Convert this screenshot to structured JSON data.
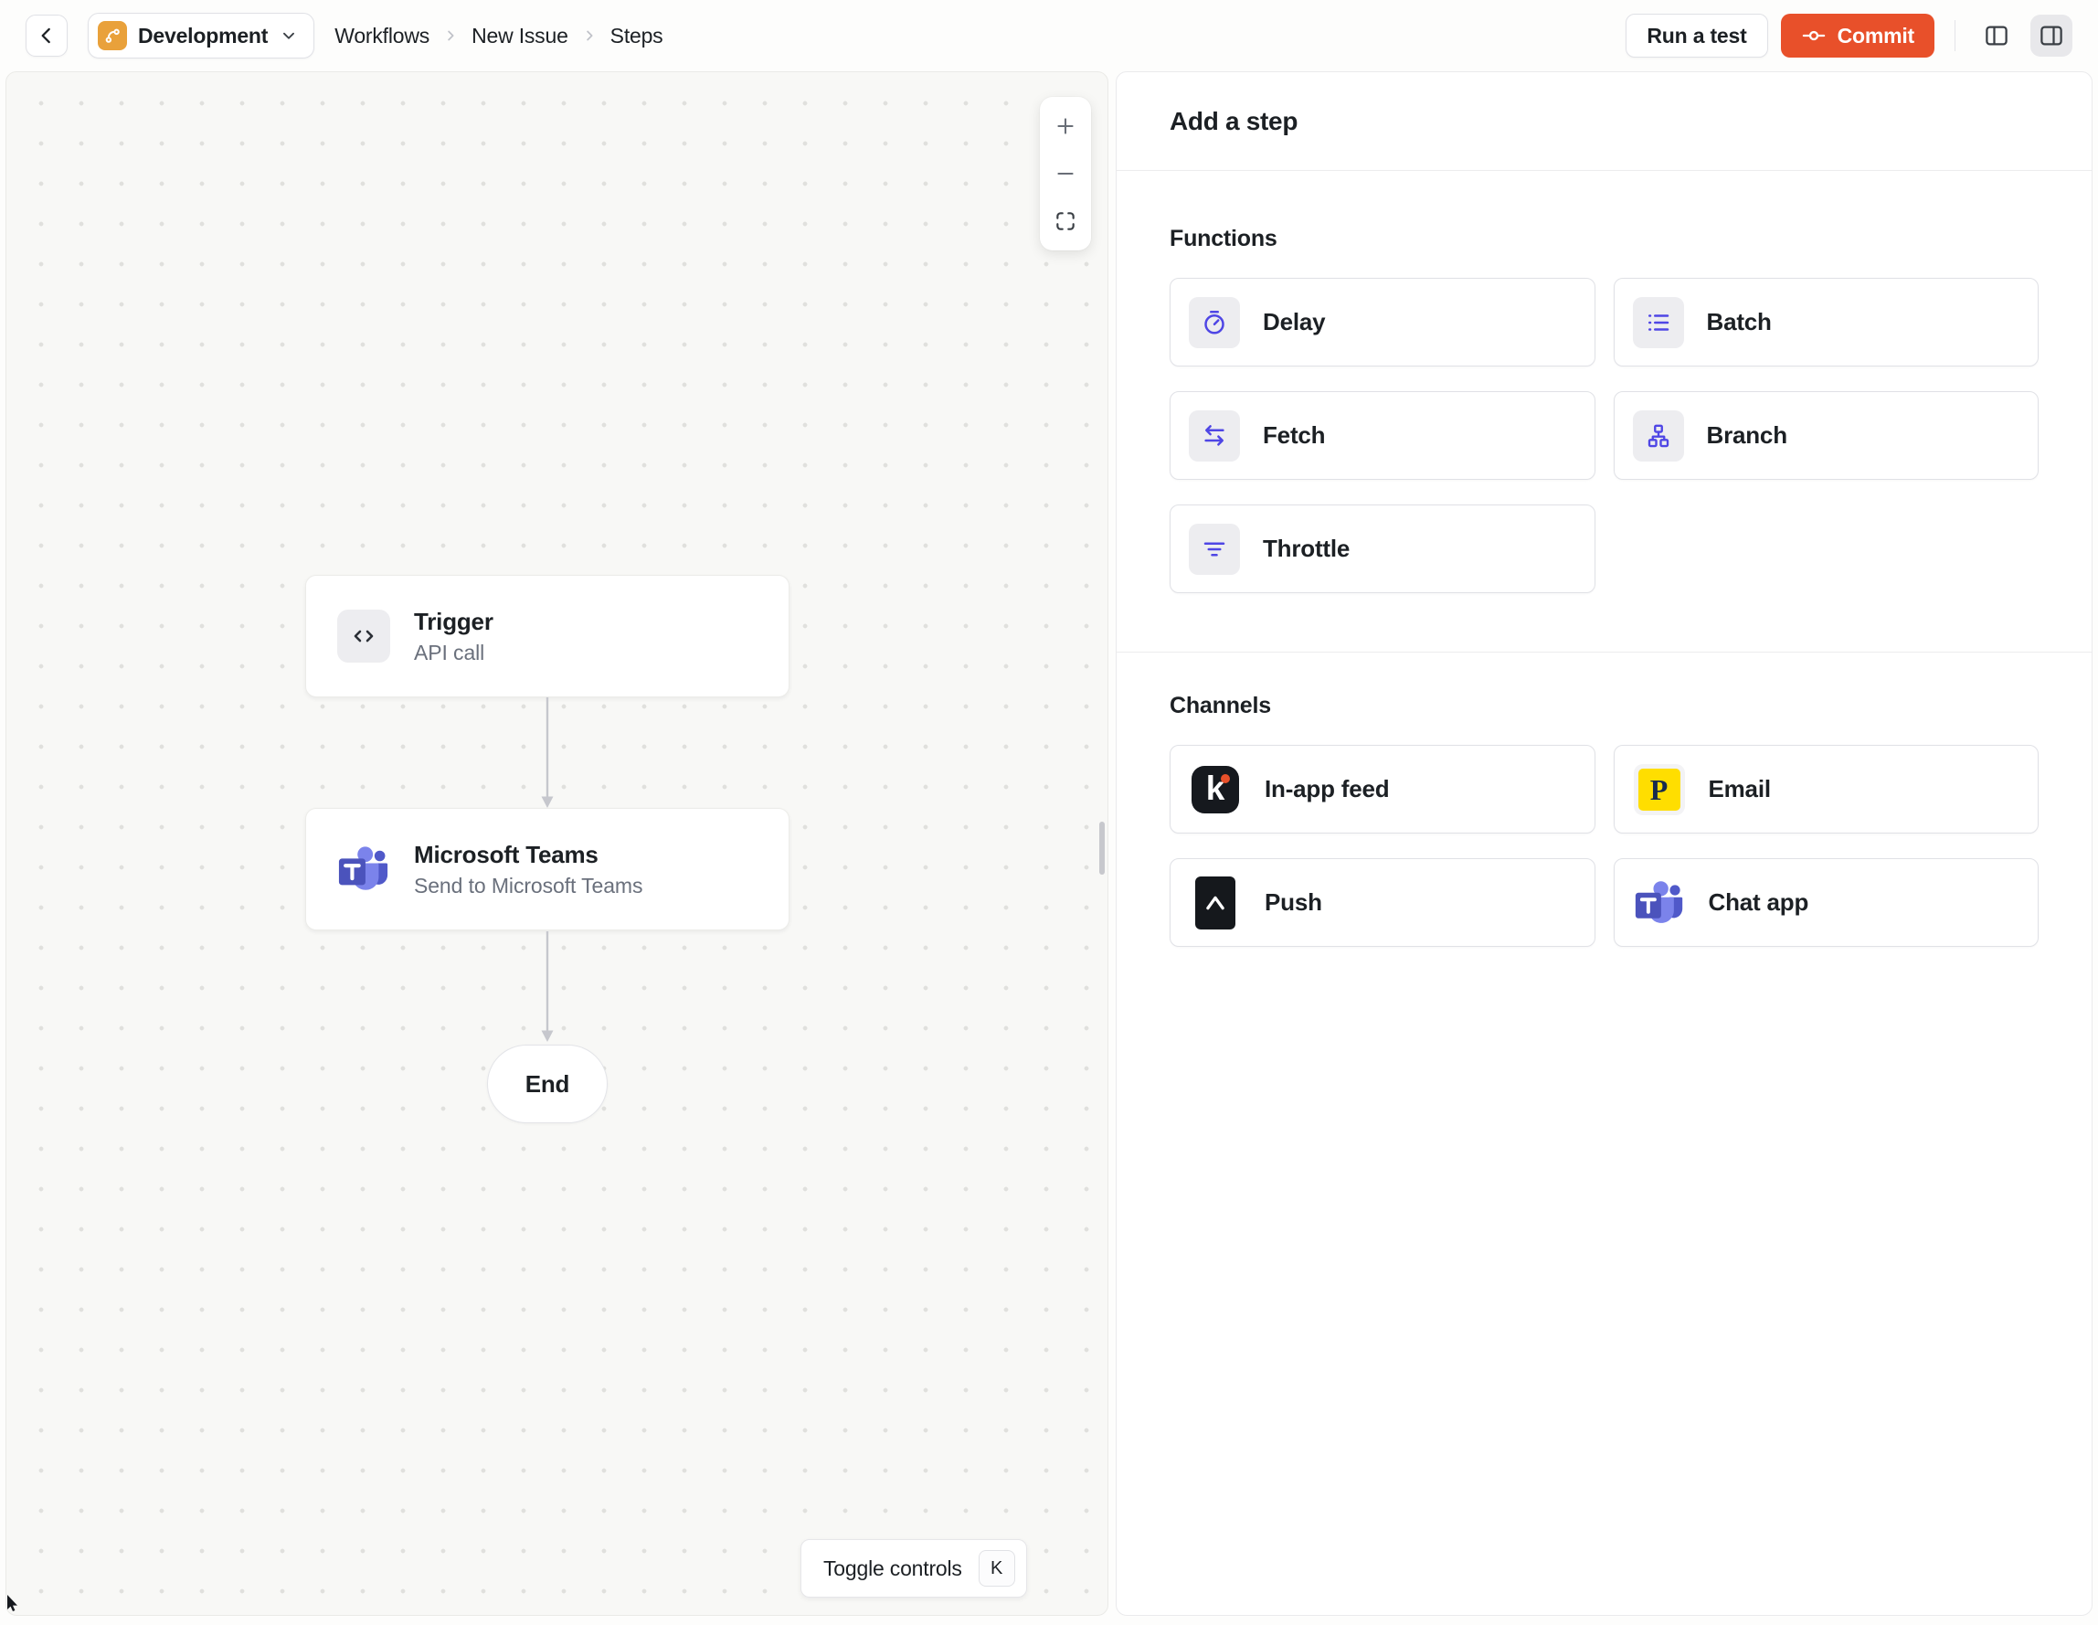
{
  "topbar": {
    "environment": "Development",
    "breadcrumb": [
      "Workflows",
      "New Issue",
      "Steps"
    ],
    "run_test_label": "Run a test",
    "commit_label": "Commit"
  },
  "canvas": {
    "trigger_node": {
      "title": "Trigger",
      "subtitle": "API call",
      "icon": "code-icon"
    },
    "teams_node": {
      "title": "Microsoft Teams",
      "subtitle": "Send to Microsoft Teams",
      "icon": "ms-teams-icon"
    },
    "end_label": "End",
    "zoom_controls": [
      "zoom-in",
      "zoom-out",
      "fit-view"
    ],
    "toggle_controls": {
      "label": "Toggle controls",
      "shortcut": "K"
    }
  },
  "panel": {
    "title": "Add a step",
    "sections": [
      {
        "label": "Functions",
        "items": [
          {
            "label": "Delay",
            "icon": "stopwatch-icon"
          },
          {
            "label": "Batch",
            "icon": "list-icon"
          },
          {
            "label": "Fetch",
            "icon": "transfer-arrows-icon"
          },
          {
            "label": "Branch",
            "icon": "org-chart-icon"
          },
          {
            "label": "Throttle",
            "icon": "funnel-lines-icon"
          }
        ]
      },
      {
        "label": "Channels",
        "items": [
          {
            "label": "In-app feed",
            "icon": "knock-logo"
          },
          {
            "label": "Email",
            "icon": "postmark-logo"
          },
          {
            "label": "Push",
            "icon": "expo-logo"
          },
          {
            "label": "Chat app",
            "icon": "ms-teams-icon"
          }
        ]
      }
    ]
  },
  "colors": {
    "commit_accent": "#E8502A",
    "function_icon": "#4F46E5",
    "environment_badge": "#E9A13B",
    "postmark_yellow": "#FFDE00",
    "teams_purple_dark": "#4B53BC",
    "teams_purple_mid": "#5059C9",
    "teams_purple_light": "#7B83EB",
    "knock_dark": "#16191E"
  }
}
